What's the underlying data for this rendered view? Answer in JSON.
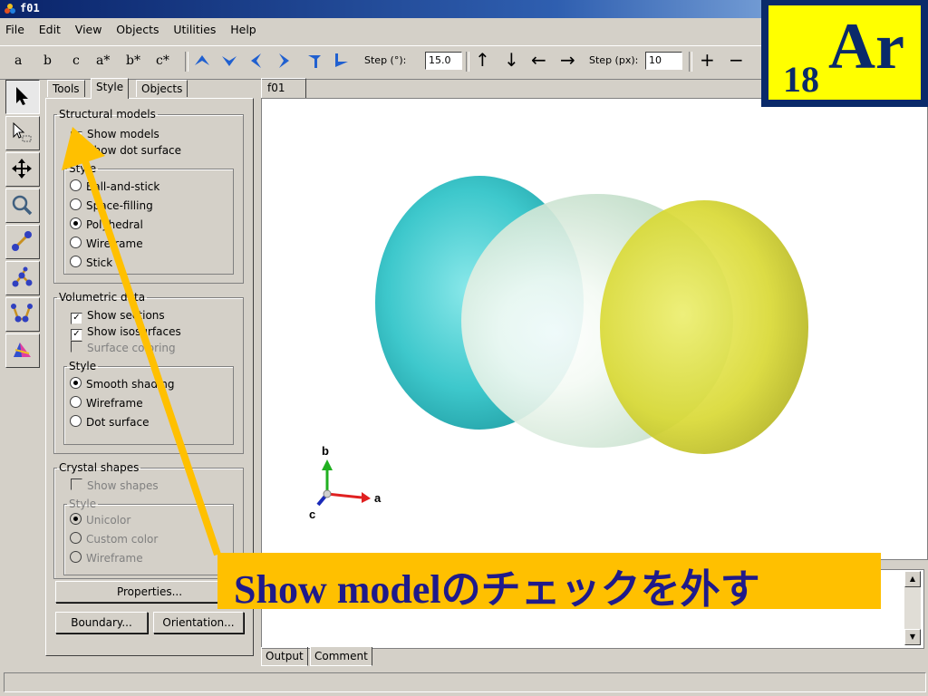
{
  "window": {
    "title": "f01"
  },
  "menu": [
    "File",
    "Edit",
    "View",
    "Objects",
    "Utilities",
    "Help"
  ],
  "toolbar": {
    "axis_buttons": [
      "a",
      "b",
      "c",
      "a*",
      "b*",
      "c*"
    ],
    "step_deg_label": "Step (°):",
    "step_deg_value": "15.0",
    "step_px_label": "Step (px):",
    "step_px_value": "10",
    "zoom_in": "+",
    "zoom_out": "−"
  },
  "panel": {
    "tabs": [
      "Tools",
      "Style",
      "Objects"
    ],
    "active_tab": "Style",
    "structural": {
      "legend": "Structural models",
      "show_models": "Show models",
      "show_dot_surface": "Show dot surface",
      "style_legend": "Style",
      "styles": [
        "Ball-and-stick",
        "Space-filling",
        "Polyhedral",
        "Wireframe",
        "Stick"
      ],
      "selected_style": "Polyhedral"
    },
    "volumetric": {
      "legend": "Volumetric data",
      "show_sections": "Show sections",
      "show_isosurfaces": "Show isosurfaces",
      "surface_coloring": "Surface coloring",
      "style_legend": "Style",
      "styles": [
        "Smooth shading",
        "Wireframe",
        "Dot surface"
      ],
      "selected_style": "Smooth shading"
    },
    "crystal": {
      "legend": "Crystal shapes",
      "show_shapes": "Show shapes",
      "style_legend": "Style",
      "styles": [
        "Unicolor",
        "Custom color",
        "Wireframe"
      ],
      "selected_style": "Unicolor"
    },
    "properties_button": "Properties...",
    "boundary_button": "Boundary...",
    "orientation_button": "Orientation..."
  },
  "viewer": {
    "tab": "f01",
    "axes": {
      "a": "a",
      "b": "b",
      "c": "c"
    },
    "colors": {
      "lobe_left": "#3ec8cc",
      "lobe_middle": "#e8f2ea",
      "lobe_right": "#d8d830",
      "axis_a": "#e02020",
      "axis_b": "#20b020",
      "axis_c": "#1a2ab8"
    }
  },
  "bottom_tabs": [
    "Output",
    "Comment"
  ],
  "overlay": {
    "element_subscript": "18",
    "element_symbol": "Ar",
    "caption": "Show modelのチェックを外す",
    "logo_bg": "#0a2a6a",
    "logo_fg": "#ffff00",
    "caption_bg": "#ffc000",
    "arrow_color": "#ffc000"
  }
}
